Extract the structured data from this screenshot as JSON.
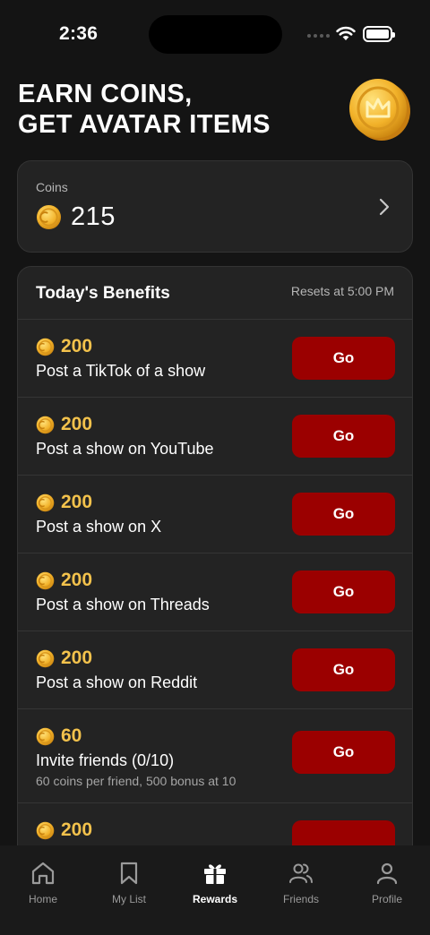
{
  "status_bar": {
    "time": "2:36"
  },
  "header": {
    "title_line1": "EARN COINS,",
    "title_line2": "GET AVATAR ITEMS"
  },
  "coins_card": {
    "label": "Coins",
    "value": "215"
  },
  "benefits": {
    "title": "Today's Benefits",
    "reset_text": "Resets at 5:00 PM",
    "tasks": [
      {
        "reward": "200",
        "title": "Post a TikTok of a show",
        "button": "Go"
      },
      {
        "reward": "200",
        "title": "Post a show on YouTube",
        "button": "Go"
      },
      {
        "reward": "200",
        "title": "Post a show on X",
        "button": "Go"
      },
      {
        "reward": "200",
        "title": "Post a show on Threads",
        "button": "Go"
      },
      {
        "reward": "200",
        "title": "Post a show on Reddit",
        "button": "Go"
      },
      {
        "reward": "60",
        "title": "Invite friends (0/10)",
        "subtitle": "60 coins per friend, 500 bonus at 10",
        "button": "Go"
      },
      {
        "reward": "200"
      }
    ]
  },
  "tab_bar": {
    "items": [
      {
        "label": "Home",
        "icon": "home-icon"
      },
      {
        "label": "My List",
        "icon": "bookmark-icon"
      },
      {
        "label": "Rewards",
        "icon": "gift-icon",
        "active": true
      },
      {
        "label": "Friends",
        "icon": "friends-icon"
      },
      {
        "label": "Profile",
        "icon": "profile-icon"
      }
    ]
  },
  "colors": {
    "accent_red": "#9b0000",
    "coin_gold": "#f3c24c",
    "background": "#141414",
    "card": "#232323"
  }
}
